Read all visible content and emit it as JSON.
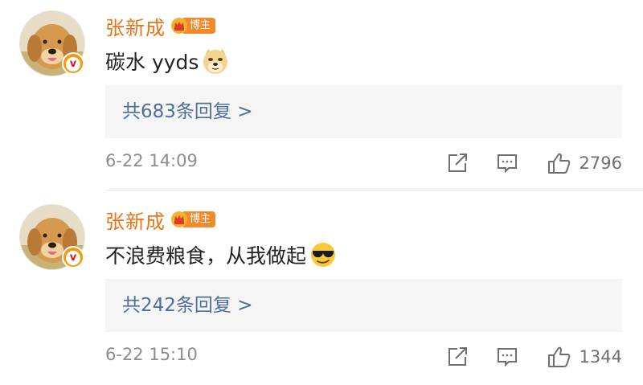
{
  "comments": [
    {
      "author": "张新成",
      "badge": "博主",
      "text": "碳水 yyds",
      "emoji": "doge-emoji",
      "replies": "共683条回复 >",
      "time": "6-22 14:09",
      "likes": "2796"
    },
    {
      "author": "张新成",
      "badge": "博主",
      "text": "不浪费粮食，从我做起",
      "emoji": "sunglasses-emoji",
      "replies": "共242条回复 >",
      "time": "6-22 15:10",
      "likes": "1344"
    }
  ],
  "colors": {
    "author": "#eb7317",
    "replies": "#506e9a",
    "meta": "#8c8c8c",
    "badge_bg": "#f08a2c"
  }
}
